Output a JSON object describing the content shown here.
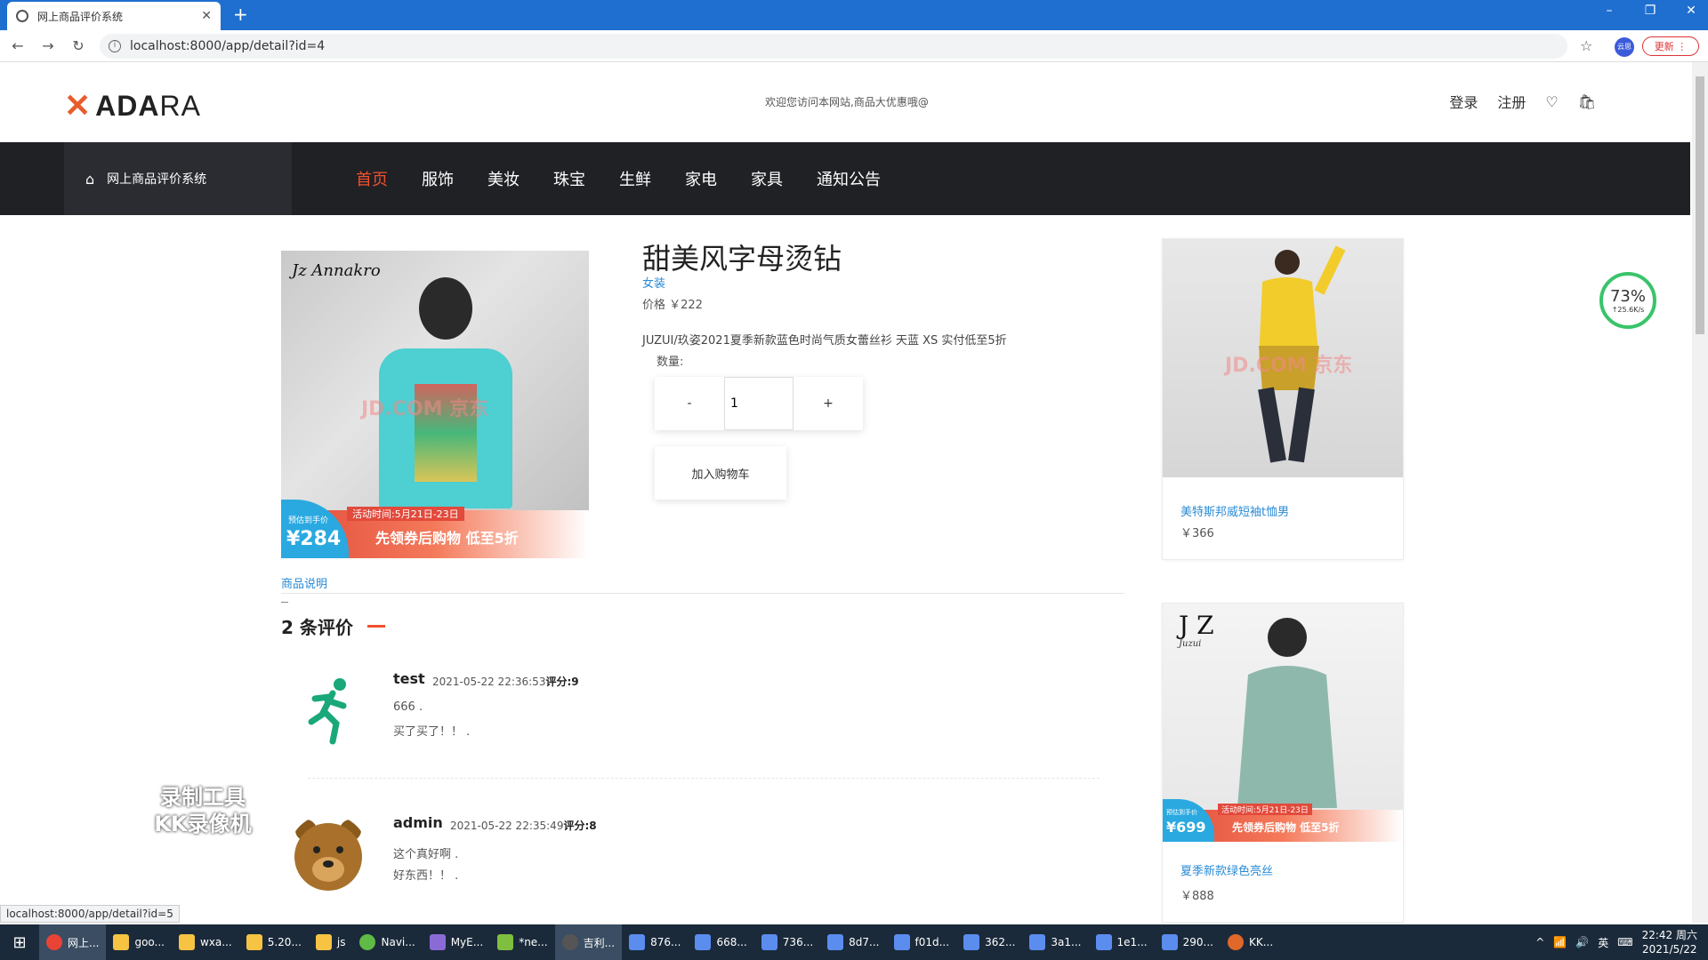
{
  "browser": {
    "tab_title": "网上商品评价系统",
    "new_tab": "+",
    "url": "localhost:8000/app/detail?id=4",
    "update_label": "更新",
    "profile_label": "云思",
    "status_url": "localhost:8000/app/detail?id=5"
  },
  "header": {
    "logo_bold": "ADA",
    "logo_rest": "RA",
    "welcome": "欢迎您访问本网站,商品大优惠哦@",
    "login": "登录",
    "register": "注册"
  },
  "nav": {
    "home_label": "网上商品评价系统",
    "links": [
      "首页",
      "服饰",
      "美妆",
      "珠宝",
      "生鲜",
      "家电",
      "家具",
      "通知公告"
    ]
  },
  "product": {
    "title": "甜美风字母烫钻",
    "category": "女装",
    "price": "价格 ￥222",
    "description": "JUZUI/玖姿2021夏季新款蓝色时尚气质女蕾丝衫 天蓝 XS 实付低至5折",
    "qty_label": "数量:",
    "minus": "-",
    "qty_value": "1",
    "plus": "+",
    "add_to_cart": "加入购物车",
    "image": {
      "brand": "Jz Annakro",
      "watermark": "JD.COM 京东",
      "time": "活动时间:5月21日-23日",
      "chip_label": "预估到手价",
      "chip_price": "¥284",
      "banner": "先领券后购物 低至5折"
    }
  },
  "details": {
    "tab_label": "商品说明",
    "reviews_title": "2 条评价"
  },
  "reviews": [
    {
      "name": "test",
      "time": "2021-05-22 22:36:53",
      "score": "评分:9",
      "line1": "666 .",
      "line2": "买了买了！！ ."
    },
    {
      "name": "admin",
      "time": "2021-05-22 22:35:49",
      "score": "评分:8",
      "line1": "这个真好啊 .",
      "line2": "好东西！！ ."
    }
  ],
  "sidebar": [
    {
      "name": "美特斯邦威短袖t恤男",
      "price": "￥366",
      "watermark": "JD.COM 京东"
    },
    {
      "name": "夏季新款绿色亮丝",
      "price": "￥888",
      "brand": "J Z",
      "brand_sub": "Juzui",
      "time": "活动时间:5月21日-23日",
      "chip_label": "预估到手价",
      "chip_price": "¥699",
      "banner": "先领券后购物 低至5折"
    }
  ],
  "speed_widget": {
    "percent": "73%",
    "rate": "↑25.6K/s"
  },
  "recorder_badge": {
    "line1": "录制工具",
    "line2": "KK录像机"
  },
  "taskbar": {
    "items": [
      "网上...",
      "goo...",
      "wxa...",
      "5.20...",
      "js",
      "Navi...",
      "MyE...",
      "*ne...",
      "吉利...",
      "876...",
      "668...",
      "736...",
      "8d7...",
      "f01d...",
      "362...",
      "3a1...",
      "1e1...",
      "290...",
      "KK..."
    ],
    "ime": "英",
    "time": "22:42 周六",
    "date": "2021/5/22"
  },
  "colors": {
    "accent": "#f0512e",
    "link": "#2a8bd6",
    "nav_bg": "#202125"
  }
}
